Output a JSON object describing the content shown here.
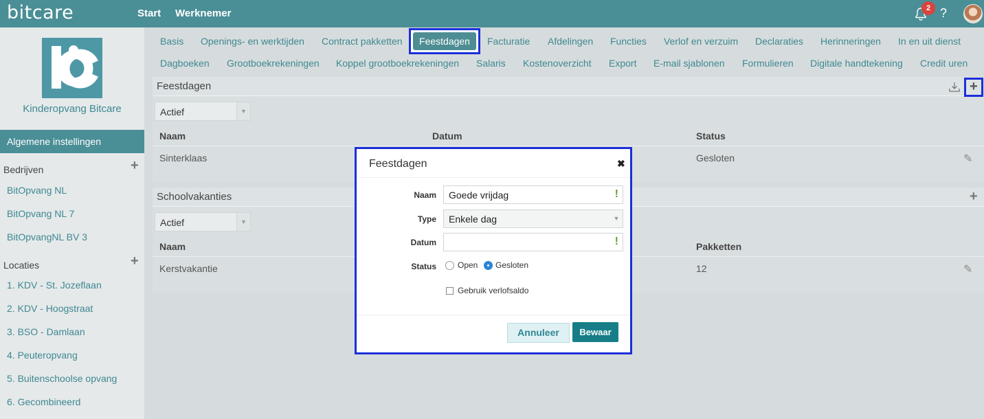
{
  "header": {
    "brand": "bitcare",
    "nav": [
      "Start",
      "Werknemer"
    ],
    "notification_count": "2",
    "help": "?"
  },
  "sidebar": {
    "org_name": "Kinderopvang Bitcare",
    "active": "Algemene instellingen",
    "bedrijven_title": "Bedrijven",
    "bedrijven": [
      "BitOpvang NL",
      "BitOpvang NL 7",
      "BitOpvangNL BV 3"
    ],
    "locaties_title": "Locaties",
    "locaties": [
      "1. KDV - St. Jozeflaan",
      "2. KDV - Hoogstraat",
      "3. BSO - Damlaan",
      "4. Peuteropvang",
      "5. Buitenschoolse opvang",
      "6. Gecombineerd"
    ]
  },
  "tabs": {
    "row1": [
      "Basis",
      "Openings- en werktijden",
      "Contract pakketten",
      "Feestdagen",
      "Facturatie",
      "Afdelingen",
      "Functies",
      "Verlof en verzuim",
      "Declaraties",
      "Herinneringen",
      "In en uit dienst"
    ],
    "row2": [
      "Dagboeken",
      "Grootboekrekeningen",
      "Koppel grootboekrekeningen",
      "Salaris",
      "Kostenoverzicht",
      "Export",
      "E-mail sjablonen",
      "Formulieren",
      "Digitale handtekening",
      "Credit uren"
    ],
    "active": "Feestdagen"
  },
  "feestdagen_panel": {
    "title": "Feestdagen",
    "filter": "Actief",
    "columns": [
      "Naam",
      "Datum",
      "Status"
    ],
    "rows": [
      {
        "naam": "Sinterklaas",
        "status": "Gesloten"
      }
    ]
  },
  "schoolvakanties_panel": {
    "title": "Schoolvakanties",
    "filter": "Actief",
    "columns": [
      "Naam",
      "Pakketten"
    ],
    "rows": [
      {
        "naam": "Kerstvakantie",
        "pakketten": "12"
      }
    ]
  },
  "modal": {
    "title": "Feestdagen",
    "close": "✖",
    "naam_label": "Naam",
    "naam_value": "Goede vrijdag",
    "type_label": "Type",
    "type_value": "Enkele dag",
    "datum_label": "Datum",
    "datum_value": "",
    "status_label": "Status",
    "status_open": "Open",
    "status_gesloten": "Gesloten",
    "status_selected": "Gesloten",
    "verlof_label": "Gebruik verlofsaldo",
    "cancel": "Annuleer",
    "save": "Bewaar"
  },
  "colors": {
    "teal": "#4a8e96",
    "highlight": "#1c2fd9",
    "link": "#3f8891",
    "badge": "#d9443c",
    "save": "#177e88"
  },
  "icons": [
    "bell-icon",
    "help-icon",
    "avatar",
    "download-icon",
    "plus-icon",
    "pencil-icon",
    "close-icon",
    "chevron-down-icon"
  ]
}
